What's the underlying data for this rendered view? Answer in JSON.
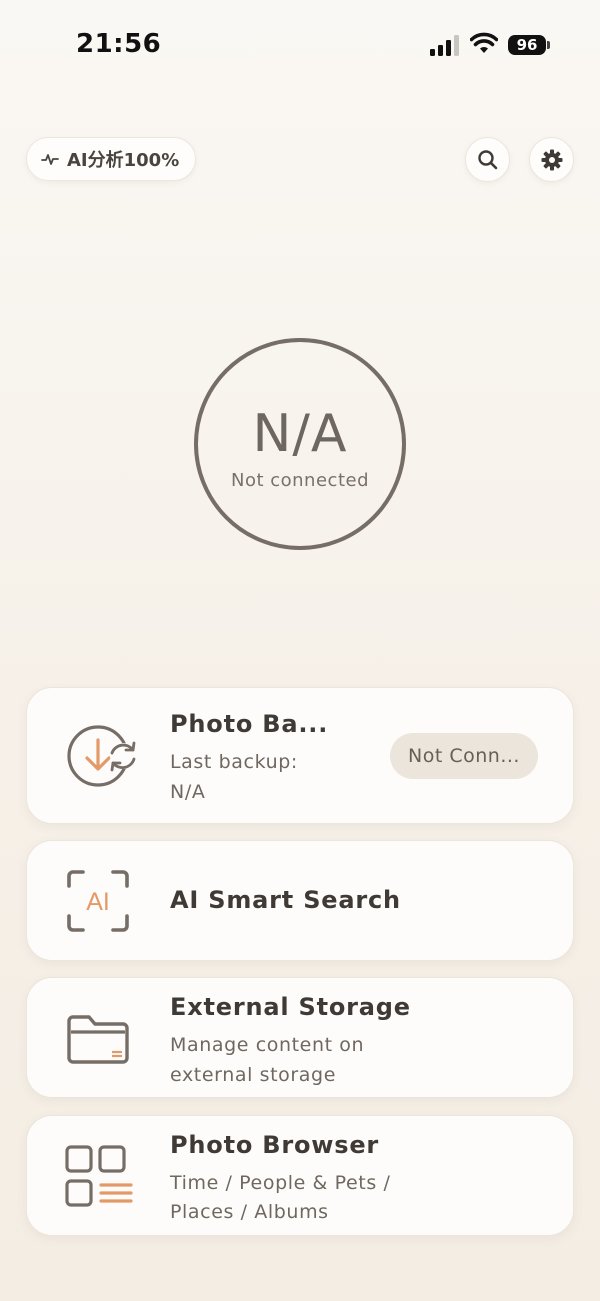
{
  "status_bar": {
    "time": "21:56",
    "battery": "96"
  },
  "header": {
    "ai_chip_label": "AI分析100%"
  },
  "center": {
    "value": "N/A",
    "status": "Not connected"
  },
  "cards": {
    "backup": {
      "title": "Photo Ba...",
      "sub_line1": "Last backup:",
      "sub_line2": "N/A",
      "status_pill": "Not Conn..."
    },
    "ai_search": {
      "title": "AI Smart Search",
      "icon_text": "AI"
    },
    "storage": {
      "title": "External Storage",
      "sub_line1": "Manage content on",
      "sub_line2": "external storage"
    },
    "browser": {
      "title": "Photo Browser",
      "sub_line1": "Time / People & Pets /",
      "sub_line2": "Places / Albums"
    }
  },
  "colors": {
    "accent": "#e39a69",
    "icon_gray": "#756d66",
    "ring": "#756d66"
  }
}
